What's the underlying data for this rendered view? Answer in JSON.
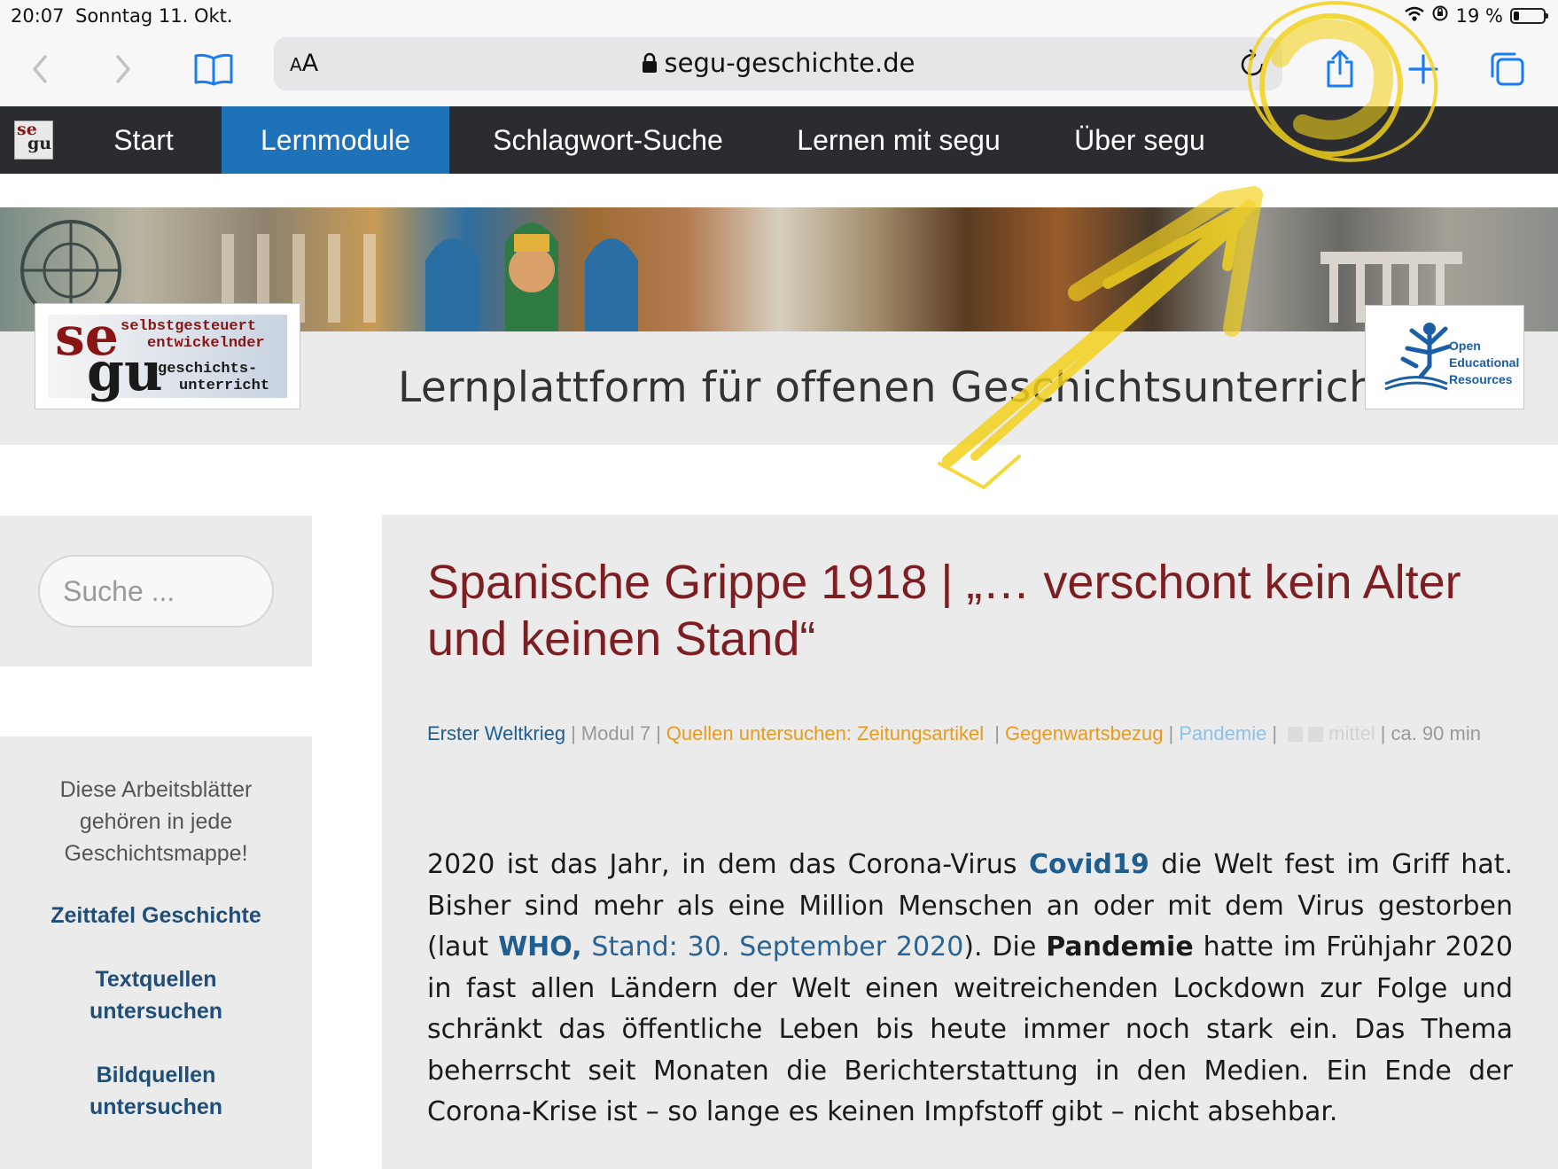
{
  "status_bar": {
    "time": "20:07",
    "date": "Sonntag 11. Okt.",
    "battery": "19 %",
    "battery_level": 0.19
  },
  "safari": {
    "aa_label_small": "A",
    "aa_label_large": "A",
    "url": "segu-geschichte.de"
  },
  "site_nav": {
    "items": [
      {
        "label": "Start"
      },
      {
        "label": "Lernmodule",
        "active": true
      },
      {
        "label": "Schlagwort-Suche"
      },
      {
        "label": "Lernen mit segu"
      },
      {
        "label": "Über segu"
      }
    ]
  },
  "banner": {
    "logo_se": "se",
    "logo_gu": "gu",
    "logo_line1": "selbstgesteuert",
    "logo_line2": "entwickelnder",
    "logo_line3": "geschichts-",
    "logo_line4": "unterricht",
    "title": "Lernplattform für offenen Geschichtsunterricht",
    "oer_line1": "Open",
    "oer_line2": "Educational",
    "oer_line3": "Resources"
  },
  "sidebar": {
    "search_placeholder": "Suche ...",
    "intro": "Diese Arbeitsblätter gehören in jede Geschichtsmappe!",
    "links": [
      {
        "label": "Zeittafel Geschichte"
      },
      {
        "label": "Textquellen untersuchen"
      },
      {
        "label": "Bildquellen untersuchen"
      }
    ]
  },
  "article": {
    "title": "Spanische Grippe 1918 | „… verschont kein Alter und keinen Stand“",
    "meta": {
      "category": "Erster Weltkrieg",
      "module": "Modul 7",
      "method": "Quellen untersuchen: Zeitungsartikel",
      "relevance": "Gegenwartsbezug",
      "tag": "Pandemie",
      "level": "mittel",
      "duration": "ca. 90 min"
    },
    "body": {
      "p1_a": "2020 ist das Jahr, in dem das Corona-Virus ",
      "link_covid": "Covid19",
      "p1_b": " die Welt fest im Griff hat. Bisher sind mehr als eine Million Menschen an oder mit dem Virus gestorben (laut ",
      "link_who": "WHO,",
      "link_stand": "Stand: 30. September 2020",
      "p1_c": "). Die ",
      "strong_pandemie": "Pandemie",
      "p1_d": " hatte im Frühjahr 2020 in fast allen Ländern der Welt einen weitreichenden Lockdown zur Folge und schränkt das öffentliche Leben bis heute immer noch stark ein. Das Thema beherrscht seit Monaten die Berichterstattung in den Medien. Ein Ende der Corona-Krise ist – so lange es keinen Impfstoff gibt – nicht absehbar."
    }
  },
  "colors": {
    "accent_blue": "#1e72b8",
    "title_red": "#7d1f22",
    "link_blue": "#2a6496",
    "annotation_yellow": "#f3d11c"
  },
  "icons": [
    "back-icon",
    "forward-icon",
    "bookmarks-icon",
    "lock-icon",
    "reload-icon",
    "share-icon",
    "new-tab-icon",
    "tabs-icon",
    "wifi-icon",
    "orientation-lock-icon",
    "oer-logo"
  ]
}
